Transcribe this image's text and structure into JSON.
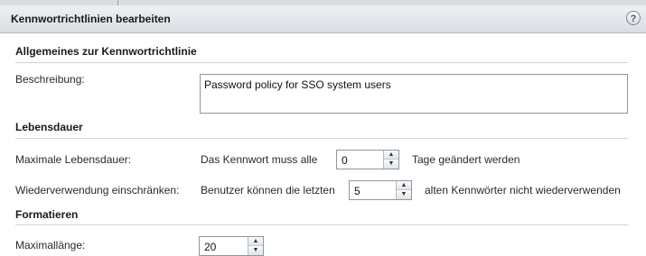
{
  "dialog": {
    "title": "Kennwortrichtlinien bearbeiten",
    "help_symbol": "?"
  },
  "general": {
    "heading": "Allgemeines zur Kennwortrichtlinie",
    "description_label": "Beschreibung:",
    "description_value": "Password policy for SSO system users"
  },
  "lifetime": {
    "heading": "Lebensdauer",
    "max_lifetime_label": "Maximale Lebensdauer:",
    "max_lifetime_prefix": "Das Kennwort muss alle",
    "max_lifetime_value": "0",
    "max_lifetime_suffix": "Tage geändert werden",
    "reuse_label": "Wiederverwendung einschränken:",
    "reuse_prefix": "Benutzer können die letzten",
    "reuse_value": "5",
    "reuse_suffix": "alten Kennwörter nicht wiederverwenden"
  },
  "format": {
    "heading": "Formatieren",
    "max_length_label": "Maximallänge:",
    "max_length_value": "20"
  },
  "icons": {
    "spinner_up": "▲",
    "spinner_down": "▼"
  }
}
